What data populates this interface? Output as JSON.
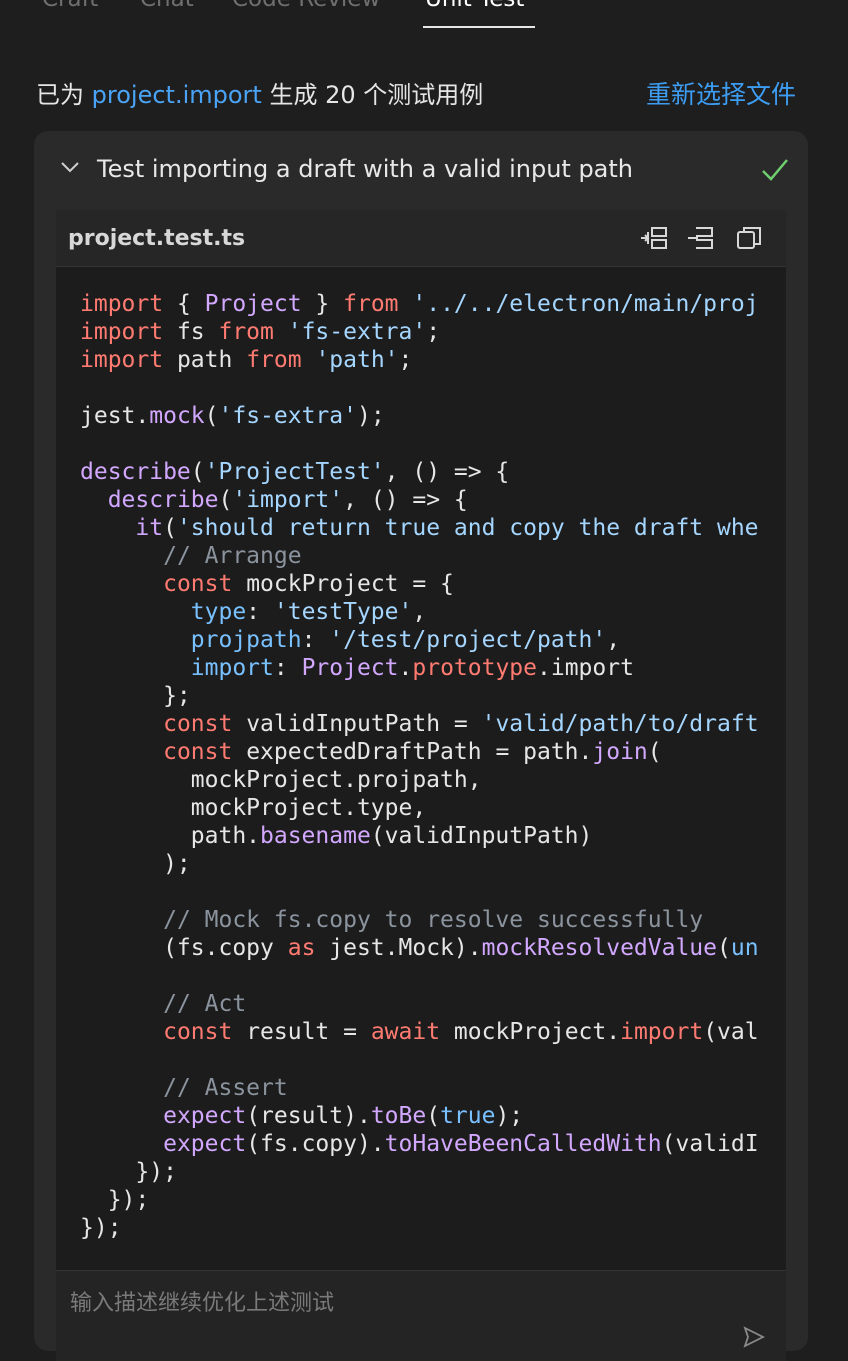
{
  "tabs": [
    {
      "label": "Craft"
    },
    {
      "label": "Chat"
    },
    {
      "label": "Code Review"
    },
    {
      "label": "Unit Test",
      "active": true
    }
  ],
  "summary": {
    "prefix": "已为 ",
    "target": "project.import",
    "suffix": " 生成 20 个测试用例"
  },
  "reselect_label": "重新选择文件",
  "test_case": {
    "title": "Test importing a draft with a valid input path",
    "status": "passed",
    "file_name": "project.test.ts"
  },
  "toolbar": {
    "icons": [
      "insert-left-icon",
      "insert-right-icon",
      "copy-icon"
    ]
  },
  "code_lines": [
    "import { Project } from '../../electron/main/proj",
    "import fs from 'fs-extra';",
    "import path from 'path';",
    "",
    "jest.mock('fs-extra');",
    "",
    "describe('ProjectTest', () => {",
    "  describe('import', () => {",
    "    it('should return true and copy the draft whe",
    "      // Arrange",
    "      const mockProject = {",
    "        type: 'testType',",
    "        projpath: '/test/project/path',",
    "        import: Project.prototype.import",
    "      };",
    "      const validInputPath = 'valid/path/to/draft",
    "      const expectedDraftPath = path.join(",
    "        mockProject.projpath,",
    "        mockProject.type,",
    "        path.basename(validInputPath)",
    "      );",
    "",
    "      // Mock fs.copy to resolve successfully",
    "      (fs.copy as jest.Mock).mockResolvedValue(un",
    "",
    "      // Act",
    "      const result = await mockProject.import(val",
    "",
    "      // Assert",
    "      expect(result).toBe(true);",
    "      expect(fs.copy).toHaveBeenCalledWith(validI",
    "    });",
    "  });",
    "});"
  ],
  "prompt": {
    "placeholder": "输入描述继续优化上述测试",
    "value": ""
  },
  "colors": {
    "background": "#1e1e1e",
    "card": "#2a2a2a",
    "link": "#4aa3f5",
    "keyword": "#ff7b72",
    "function": "#d2a8ff",
    "string": "#a5d6ff",
    "property": "#79c0ff",
    "comment": "#8b949e",
    "success": "#6fcf6f"
  }
}
